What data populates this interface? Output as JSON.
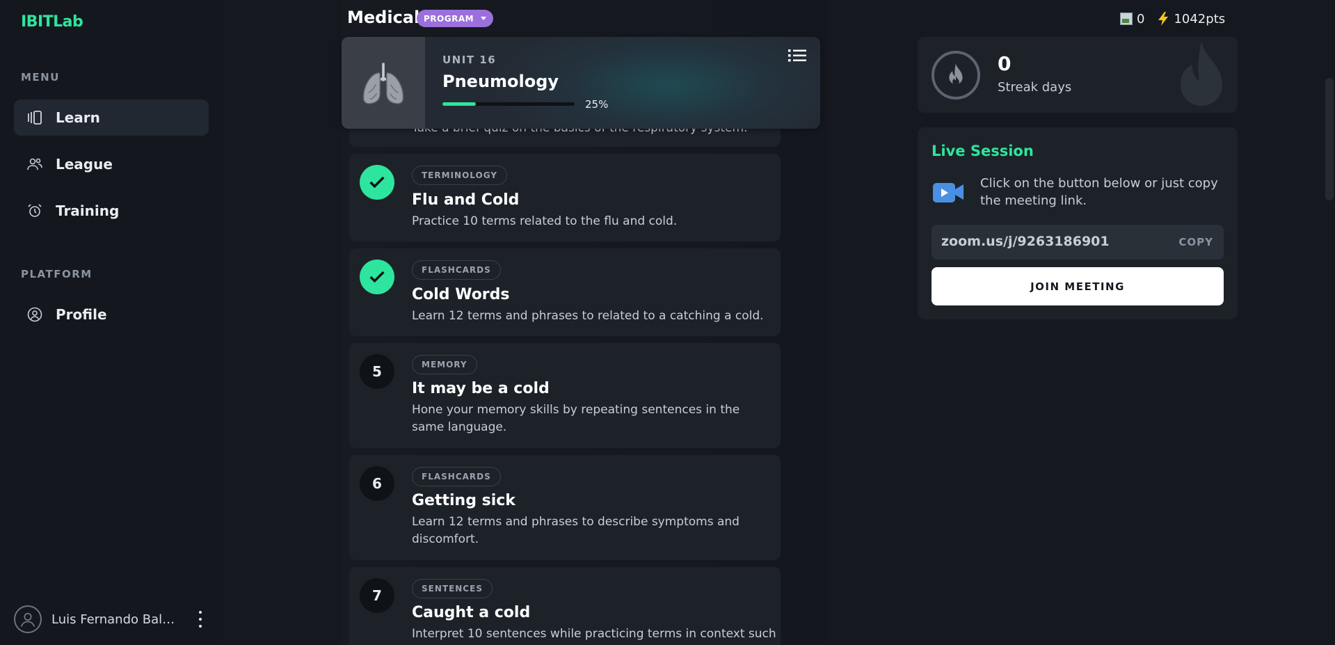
{
  "app": {
    "logo": "IBITLab"
  },
  "sidebar": {
    "menu_label": "MENU",
    "menu_items": [
      {
        "label": "Learn",
        "icon": "learn-cards-icon",
        "active": true
      },
      {
        "label": "League",
        "icon": "users-icon",
        "active": false
      },
      {
        "label": "Training",
        "icon": "alarm-clock-icon",
        "active": false
      }
    ],
    "platform_label": "PLATFORM",
    "platform_items": [
      {
        "label": "Profile",
        "icon": "user-circle-icon",
        "active": false
      }
    ],
    "user": {
      "name": "Luis Fernando Bald..."
    }
  },
  "header": {
    "course": "Medical",
    "program_badge": "PROGRAM",
    "stats": {
      "image_count": "0",
      "points": "1042pts"
    }
  },
  "unit": {
    "number_label": "UNIT 16",
    "name": "Pneumology",
    "progress": 0.25,
    "progress_label": "25%"
  },
  "lessons": [
    {
      "status": "partial",
      "tag": "",
      "title": "",
      "desc": "Take a brief quiz on the basics of the respiratory system."
    },
    {
      "status": "done",
      "number": "",
      "tag": "TERMINOLOGY",
      "title": "Flu and Cold",
      "desc": "Practice 10 terms related to the flu and cold."
    },
    {
      "status": "done",
      "number": "",
      "tag": "FLASHCARDS",
      "title": "Cold Words",
      "desc": "Learn 12 terms and phrases to related to a catching a cold."
    },
    {
      "status": "num",
      "number": "5",
      "tag": "MEMORY",
      "title": "It may be a cold",
      "desc": "Hone your memory skills by repeating sentences in the same language."
    },
    {
      "status": "num",
      "number": "6",
      "tag": "FLASHCARDS",
      "title": "Getting sick",
      "desc": "Learn 12 terms and phrases to describe symptoms and discomfort."
    },
    {
      "status": "num",
      "number": "7",
      "tag": "SENTENCES",
      "title": "Caught a cold",
      "desc": "Interpret 10 sentences while practicing terms in context such"
    }
  ],
  "streak": {
    "count": "0",
    "label": "Streak days"
  },
  "live_session": {
    "title": "Live Session",
    "text": "Click on the button below or just copy the meeting link.",
    "link": "zoom.us/j/9263186901",
    "copy_label": "COPY",
    "join_label": "JOIN MEETING"
  },
  "colors": {
    "accent": "#2ee59d",
    "badge": "#9b6fdc",
    "background": "#15191f",
    "card": "#1d2229"
  }
}
